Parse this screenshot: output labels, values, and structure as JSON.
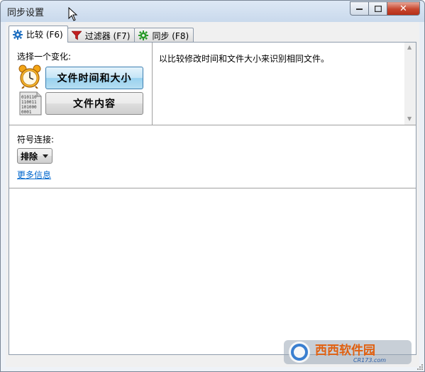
{
  "window": {
    "title": "同步设置",
    "close_symbol": "✕"
  },
  "tabs": [
    {
      "label": "比较 (F6)",
      "icon": "gear-icon",
      "icon_color": "#1f6fc0",
      "active": true
    },
    {
      "label": "过滤器 (F7)",
      "icon": "funnel-icon",
      "icon_color": "#c21f1f",
      "active": false
    },
    {
      "label": "同步 (F8)",
      "icon": "gear-icon",
      "icon_color": "#2a9a2a",
      "active": false
    }
  ],
  "compare": {
    "select_label": "选择一个变化:",
    "time_size_button": "文件时间和大小",
    "content_button": "文件内容",
    "description": "以比较修改时间和文件大小来识别相同文件。"
  },
  "symlink": {
    "label": "符号连接:",
    "dropdown_value": "排除",
    "more_info": "更多信息"
  },
  "binary_icon_lines": [
    "010110",
    "110011",
    "101000",
    "0001"
  ],
  "watermark": {
    "brand": "西西软件园",
    "domain": "CR173.com"
  }
}
